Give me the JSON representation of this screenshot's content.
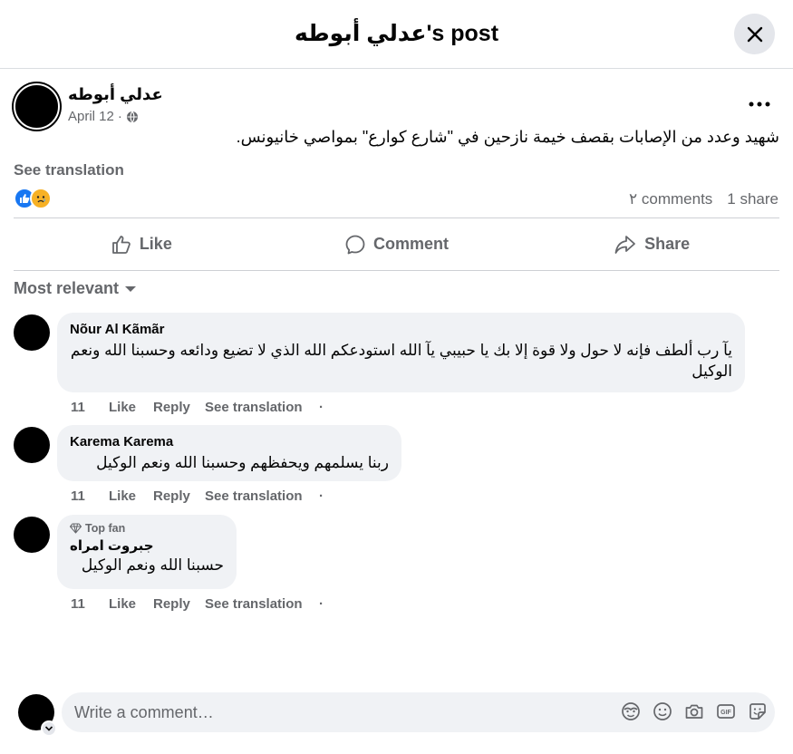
{
  "header": {
    "title": "عدلي أبوطه's post"
  },
  "post": {
    "author": "عدلي أبوطه",
    "date": "April 12",
    "dot": "·",
    "text": "شهيد وعدد من الإصابات بقصف خيمة نازحين في  \"شارع كوارع\" بمواصي خانيونس.",
    "see_translation": "See translation",
    "comments_count": "٢ comments",
    "shares_count": "1 share"
  },
  "actions": {
    "like": "Like",
    "comment": "Comment",
    "share": "Share"
  },
  "sort": {
    "label": "Most relevant"
  },
  "comments": [
    {
      "name": "Nõur Al Kãmãr",
      "text": "يآ رب ألطف فإنه لا حول ولا قوة إلا بك يا حبيبي يآ الله استودعكم الله الذي لا تضيع ودائعه وحسبنا الله ونعم الوكيل",
      "time": "11",
      "like": "Like",
      "reply": "Reply",
      "translation": "See translation",
      "dot": "·"
    },
    {
      "name": "Karema Karema",
      "text": "ربنا يسلمهم ويحفظهم وحسبنا الله ونعم الوكيل",
      "time": "11",
      "like": "Like",
      "reply": "Reply",
      "translation": "See translation",
      "dot": "·"
    },
    {
      "badge": "Top fan",
      "name": "جبروت امراه",
      "text": "حسبنا الله ونعم الوكيل",
      "time": "11",
      "like": "Like",
      "reply": "Reply",
      "translation": "See translation",
      "dot": "·"
    }
  ],
  "composer": {
    "placeholder": "Write a comment…"
  },
  "colors": {
    "like_blue": "#1877f2",
    "sad_yellow": "#f7b125",
    "secondary_text": "#65676b",
    "bubble_bg": "#f0f2f5"
  },
  "icons": [
    "close-icon",
    "globe-icon",
    "more-icon",
    "like-icon",
    "sad-reaction-icon",
    "comment-icon",
    "share-icon",
    "caret-down-icon",
    "diamond-icon",
    "avatar-sticker-icon",
    "emoji-icon",
    "camera-icon",
    "gif-icon",
    "sticker-icon"
  ]
}
